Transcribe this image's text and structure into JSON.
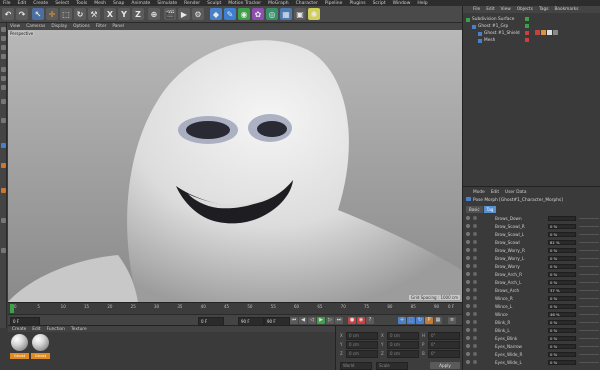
{
  "menubar": [
    "File",
    "Edit",
    "Create",
    "Select",
    "Tools",
    "Mesh",
    "Snap",
    "Animate",
    "Simulate",
    "Render",
    "Sculpt",
    "Motion Tracker",
    "MoGraph",
    "Character",
    "Pipeline",
    "Plugins",
    "Script",
    "Window",
    "Help"
  ],
  "toolbar": {
    "axis_x": "X",
    "axis_y": "Y",
    "axis_z": "Z"
  },
  "viewport": {
    "menu": [
      "View",
      "Cameras",
      "Display",
      "Options",
      "Filter",
      "Panel"
    ],
    "label": "Perspective",
    "grid_spacing": "Grid Spacing : 1000 cm"
  },
  "timeline": {
    "ticks": [
      "0",
      "5",
      "10",
      "15",
      "20",
      "25",
      "30",
      "35",
      "40",
      "45",
      "50",
      "55",
      "60",
      "65",
      "70",
      "75",
      "80",
      "85",
      "90"
    ],
    "end": "0 F"
  },
  "transport": {
    "current": "0 F",
    "start": "0 F",
    "end": "90 F",
    "end2": "90 F"
  },
  "material_panel": {
    "menu": [
      "Create",
      "Edit",
      "Function",
      "Texture"
    ],
    "materials": [
      "Ghost",
      "Ghost"
    ]
  },
  "coord_panel": {
    "rows": [
      {
        "axis": "X",
        "value": "0 cm",
        "axis2": "X",
        "value2": "0 cm",
        "axis3": "H",
        "value3": "0°"
      },
      {
        "axis": "Y",
        "value": "0 cm",
        "axis2": "Y",
        "value2": "0 cm",
        "axis3": "P",
        "value3": "0°"
      },
      {
        "axis": "Z",
        "value": "0 cm",
        "axis2": "Z",
        "value2": "0 cm",
        "axis3": "B",
        "value3": "0°"
      }
    ],
    "mode1": "World",
    "mode2": "Scale",
    "apply": "Apply"
  },
  "object_manager": {
    "menu": [
      "File",
      "Edit",
      "View",
      "Objects",
      "Tags",
      "Bookmarks"
    ],
    "objects": [
      "Subdivision Surface",
      "Ghost #1_Grp",
      "Ghost #1_Shield",
      "Mesh"
    ]
  },
  "attributes": {
    "menu": [
      "Mode",
      "Edit",
      "User Data"
    ],
    "title": "Pose Morph [Ghost#1_Character_Morphs]",
    "tabs": [
      "Basic",
      "Tag"
    ],
    "morphs": [
      {
        "name": "Brows_Down",
        "value": ""
      },
      {
        "name": "Brow_Scowl_R",
        "value": "0 %"
      },
      {
        "name": "Brow_Scowl_L",
        "value": "0 %"
      },
      {
        "name": "Brow_Scowl",
        "value": "81 %"
      },
      {
        "name": "Brow_Worry_R",
        "value": "0 %"
      },
      {
        "name": "Brow_Worry_L",
        "value": "0 %"
      },
      {
        "name": "Brow_Worry",
        "value": "0 %"
      },
      {
        "name": "Brow_Arch_R",
        "value": "0 %"
      },
      {
        "name": "Brow_Arch_L",
        "value": "0 %"
      },
      {
        "name": "Brows_Arch",
        "value": "37 %"
      },
      {
        "name": "Wince_R",
        "value": "0 %"
      },
      {
        "name": "Wince_L",
        "value": "0 %"
      },
      {
        "name": "Wince",
        "value": "46 %"
      },
      {
        "name": "Blink_R",
        "value": "0 %"
      },
      {
        "name": "Blink_L",
        "value": "0 %"
      },
      {
        "name": "Eyes_Blink",
        "value": "0 %"
      },
      {
        "name": "Eyes_Narrow",
        "value": "0 %"
      },
      {
        "name": "Eyes_Wide_R",
        "value": "0 %"
      },
      {
        "name": "Eyes_Wide_L",
        "value": "0 %"
      }
    ]
  }
}
